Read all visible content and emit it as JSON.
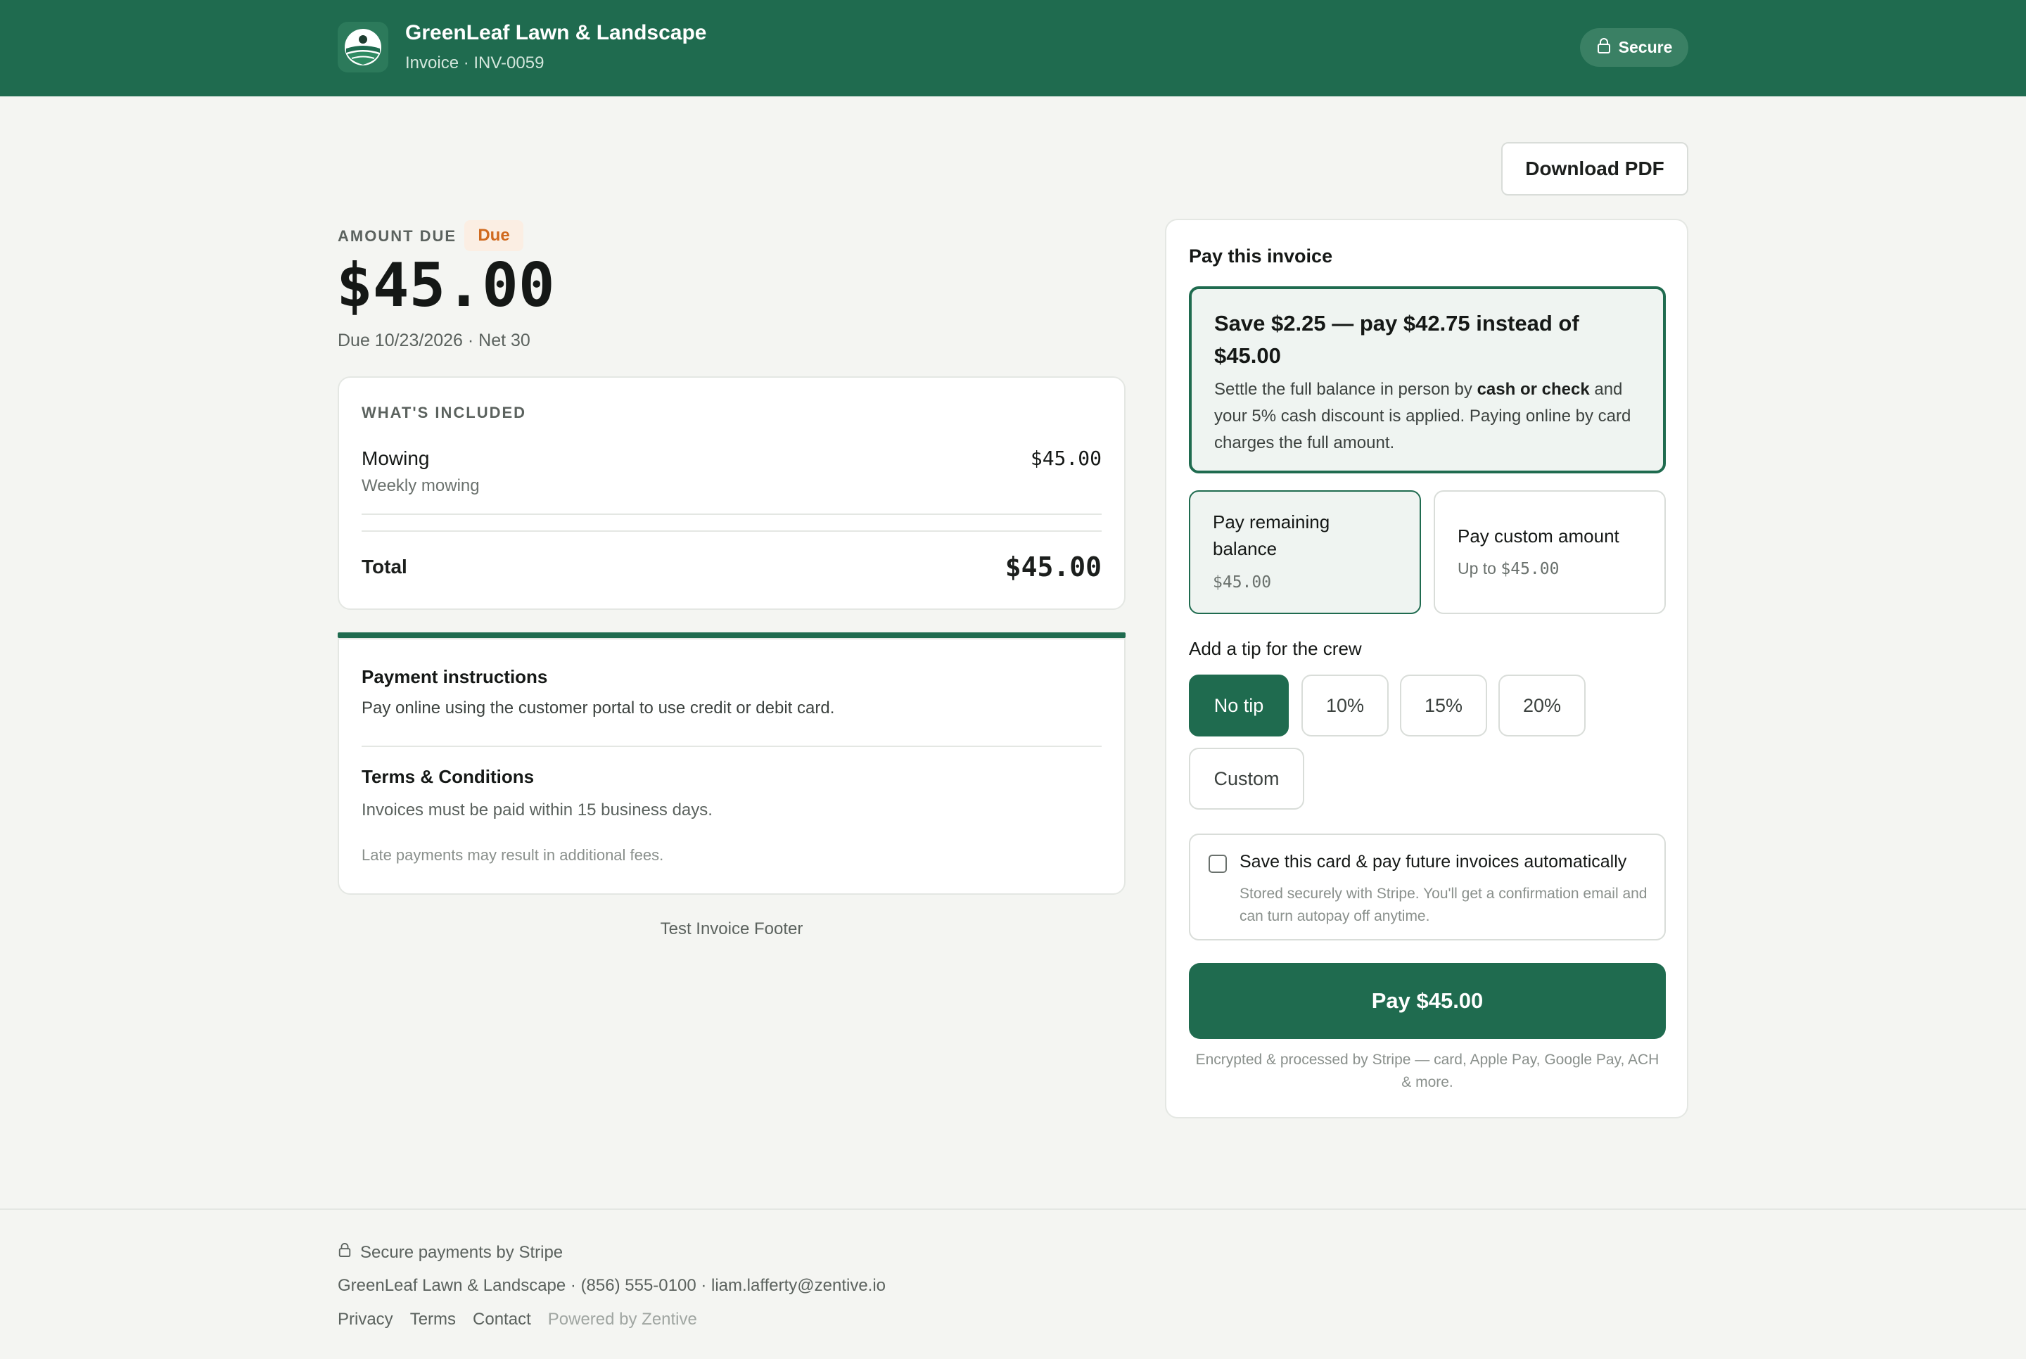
{
  "header": {
    "brand_name": "GreenLeaf Lawn & Landscape",
    "invoice_label": "Invoice · INV-0059",
    "secure_label": "Secure"
  },
  "toolbar": {
    "download_label": "Download PDF"
  },
  "summary": {
    "amount_label": "AMOUNT DUE",
    "status_badge": "Due",
    "amount": "$45.00",
    "due_text": "Due 10/23/2026 · Net 30"
  },
  "included": {
    "title": "WHAT'S INCLUDED",
    "items": [
      {
        "name": "Mowing",
        "description": "Weekly mowing",
        "amount": "$45.00"
      }
    ],
    "total_label": "Total",
    "total_amount": "$45.00"
  },
  "instructions": {
    "payment_title": "Payment instructions",
    "payment_text": "Pay online using the customer portal to use credit or debit card.",
    "terms_title": "Terms & Conditions",
    "terms_text": "Invoices must be paid within 15 business days.",
    "terms_note": "Late payments may result in additional fees."
  },
  "invoice_footer": "Test Invoice Footer",
  "pay": {
    "title": "Pay this invoice",
    "discount_title": "Save $2.25 — pay $42.75 instead of $45.00",
    "discount_body_1": "Settle the full balance in person by ",
    "discount_body_bold": "cash or check",
    "discount_body_2": " and your 5% cash discount is applied. Paying online by card charges the full amount.",
    "options": [
      {
        "label": "Pay remaining balance",
        "sub": "$45.00",
        "selected": true
      },
      {
        "label": "Pay custom amount",
        "sub": "Up to $45.00",
        "selected": false
      }
    ],
    "tip_label": "Add a tip for the crew",
    "tips": [
      "No tip",
      "10%",
      "15%",
      "20%",
      "Custom"
    ],
    "tip_selected": "No tip",
    "autopay_title": "Save this card & pay future invoices automatically",
    "autopay_sub": "Stored securely with Stripe. You'll get a confirmation email and can turn autopay off anytime.",
    "autopay_checked": false,
    "pay_button": "Pay $45.00",
    "stripe_note": "Encrypted & processed by Stripe — card, Apple Pay, Google Pay, ACH & more."
  },
  "footer": {
    "secure_text": "Secure payments by Stripe",
    "contact": "GreenLeaf Lawn & Landscape · (856) 555-0100 · liam.lafferty@zentive.io",
    "links": [
      "Privacy",
      "Terms",
      "Contact"
    ],
    "powered": "Powered by Zentive"
  },
  "colors": {
    "brand": "#1f6b4f",
    "background": "#f4f5f2",
    "due_badge_text": "#d06a1f",
    "due_badge_bg": "#fbeee3"
  },
  "icons": [
    "logo-icon",
    "lock-icon",
    "checkbox"
  ]
}
